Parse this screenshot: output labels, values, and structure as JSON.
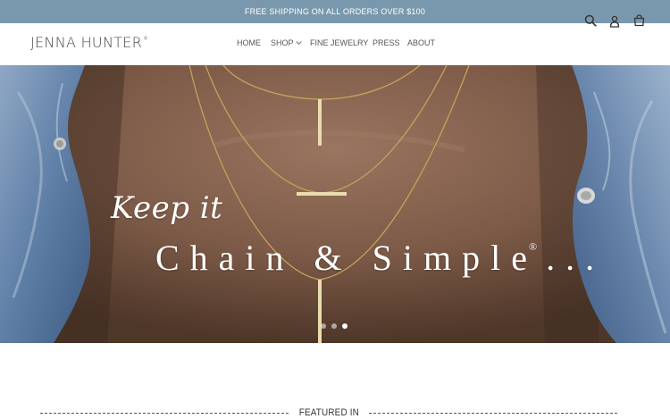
{
  "announcement": {
    "text": "FREE SHIPPING ON ALL ORDERS OVER $100"
  },
  "header": {
    "logo_text": "JENNA HUNTER",
    "logo_mark": "®",
    "nav": [
      {
        "label": "HOME"
      },
      {
        "label": "SHOP",
        "has_dropdown": true
      },
      {
        "label": "FINE JEWELRY"
      },
      {
        "label": "PRESS"
      },
      {
        "label": "ABOUT"
      }
    ],
    "icons": [
      "search-icon",
      "account-icon",
      "cart-icon"
    ]
  },
  "hero": {
    "line1": "Keep it",
    "line2": "Chain & Simple",
    "line2_mark": "®",
    "line2_suffix": "...",
    "slides_total": 3,
    "active_slide": 3
  },
  "featured": {
    "label": "FEATURED IN"
  },
  "colors": {
    "announcement_bg": "#7a98ad",
    "text_dark": "#3a3a3a",
    "gold": "#c9a65a",
    "denim": "#5f7fa7"
  }
}
